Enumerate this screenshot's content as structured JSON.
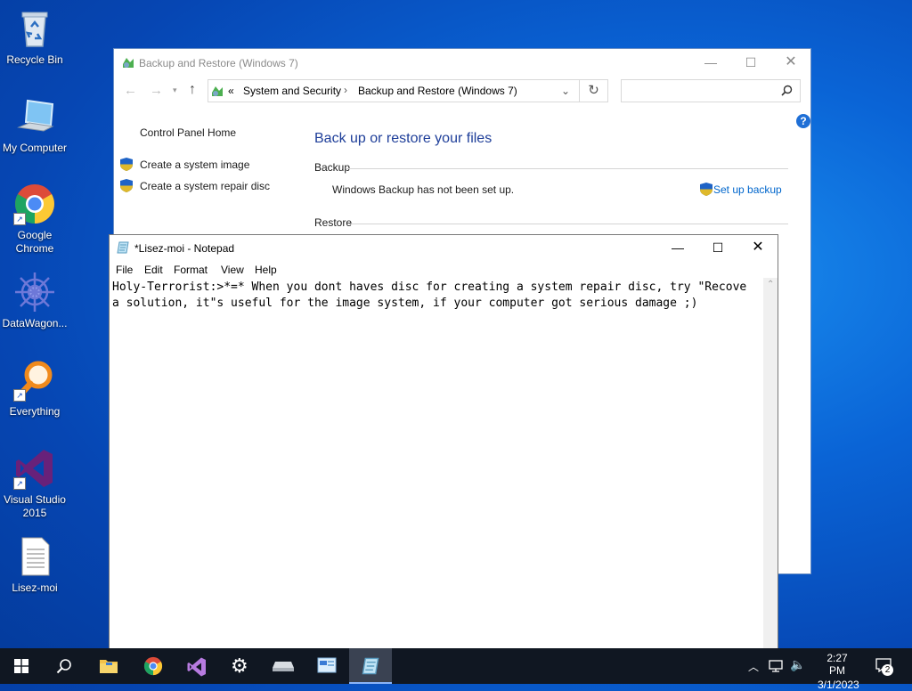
{
  "desktop": {
    "icons": [
      {
        "label": "Recycle Bin"
      },
      {
        "label": "My Computer"
      },
      {
        "label": "Google Chrome"
      },
      {
        "label": "DataWagon..."
      },
      {
        "label": "Everything"
      },
      {
        "label": "Visual Studio 2015"
      },
      {
        "label": "Lisez-moi"
      }
    ]
  },
  "control_panel": {
    "title": "Backup and Restore (Windows 7)",
    "breadcrumb": {
      "chevron": "«",
      "items": [
        "System and Security",
        "Backup and Restore (Windows 7)"
      ]
    },
    "search_placeholder": "",
    "sidebar": {
      "home": "Control Panel Home",
      "links": [
        "Create a system image",
        "Create a system repair disc"
      ]
    },
    "heading": "Back up or restore your files",
    "backup_section": "Backup",
    "backup_status": "Windows Backup has not been set up.",
    "setup_link": "Set up backup",
    "restore_section": "Restore"
  },
  "notepad": {
    "title": "*Lisez-moi - Notepad",
    "menu": [
      "File",
      "Edit",
      "Format",
      "View",
      "Help"
    ],
    "content": "Holy-Terrorist:>*=* When you dont haves disc for creating a system repair disc, try \"Recove\na solution, it\"s useful for the image system, if your computer got serious damage ;)"
  },
  "taskbar": {
    "time": "2:27 PM",
    "date": "3/1/2023",
    "notification_count": "2",
    "items": [
      "start",
      "search",
      "file-explorer",
      "chrome",
      "visual-studio",
      "settings",
      "drive",
      "control-panel",
      "notepad"
    ]
  },
  "colors": {
    "accent_blue": "#1e3e99",
    "link_blue": "#0066cc",
    "desktop_blue": "#0a64d6",
    "taskbar": "#101722"
  }
}
